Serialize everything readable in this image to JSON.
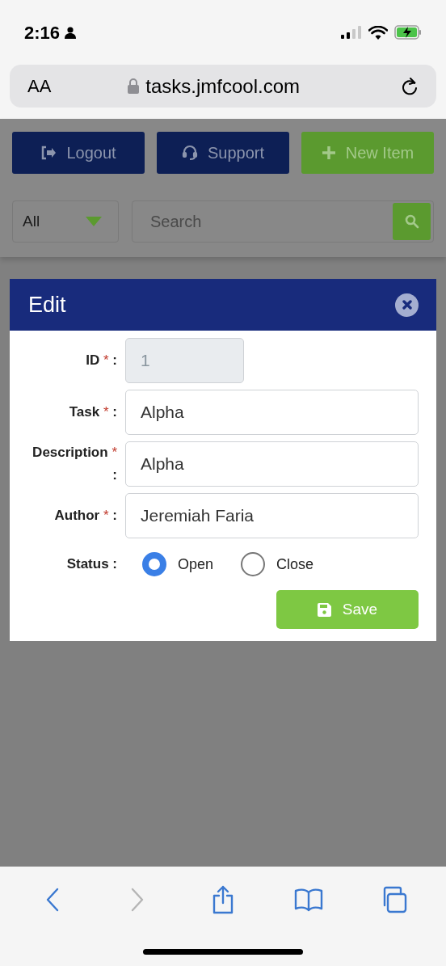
{
  "status_bar": {
    "time": "2:16"
  },
  "address_bar": {
    "text_size": "AA",
    "url": "tasks.jmfcool.com"
  },
  "page": {
    "buttons": [
      {
        "kind": "logout",
        "label": "Logout"
      },
      {
        "kind": "support",
        "label": "Support"
      },
      {
        "kind": "new",
        "label": "New Item"
      }
    ],
    "filter": {
      "value": "All"
    },
    "search": {
      "placeholder": "Search"
    }
  },
  "dialog": {
    "title": "Edit",
    "fields": [
      {
        "label": "ID",
        "required_mark": "*",
        "colon": ":",
        "value": "1",
        "disabled": true
      },
      {
        "label": "Task",
        "required_mark": "*",
        "colon": ":",
        "value": "Alpha",
        "disabled": false
      },
      {
        "label": "Description",
        "required_mark": "*",
        "colon": ":",
        "value": "Alpha",
        "disabled": false
      },
      {
        "label": "Author",
        "required_mark": "*",
        "colon": ":",
        "value": "Jeremiah Faria",
        "disabled": false
      }
    ],
    "status": {
      "label": "Status",
      "colon": ":",
      "options": [
        {
          "label": "Open",
          "selected": true
        },
        {
          "label": "Close",
          "selected": false
        }
      ]
    },
    "save": "Save"
  },
  "toolbar": [
    {
      "kind": "back",
      "disabled": false
    },
    {
      "kind": "forward",
      "disabled": true
    },
    {
      "kind": "share",
      "disabled": false
    },
    {
      "kind": "bookmarks",
      "disabled": false
    },
    {
      "kind": "tabs",
      "disabled": false
    }
  ]
}
